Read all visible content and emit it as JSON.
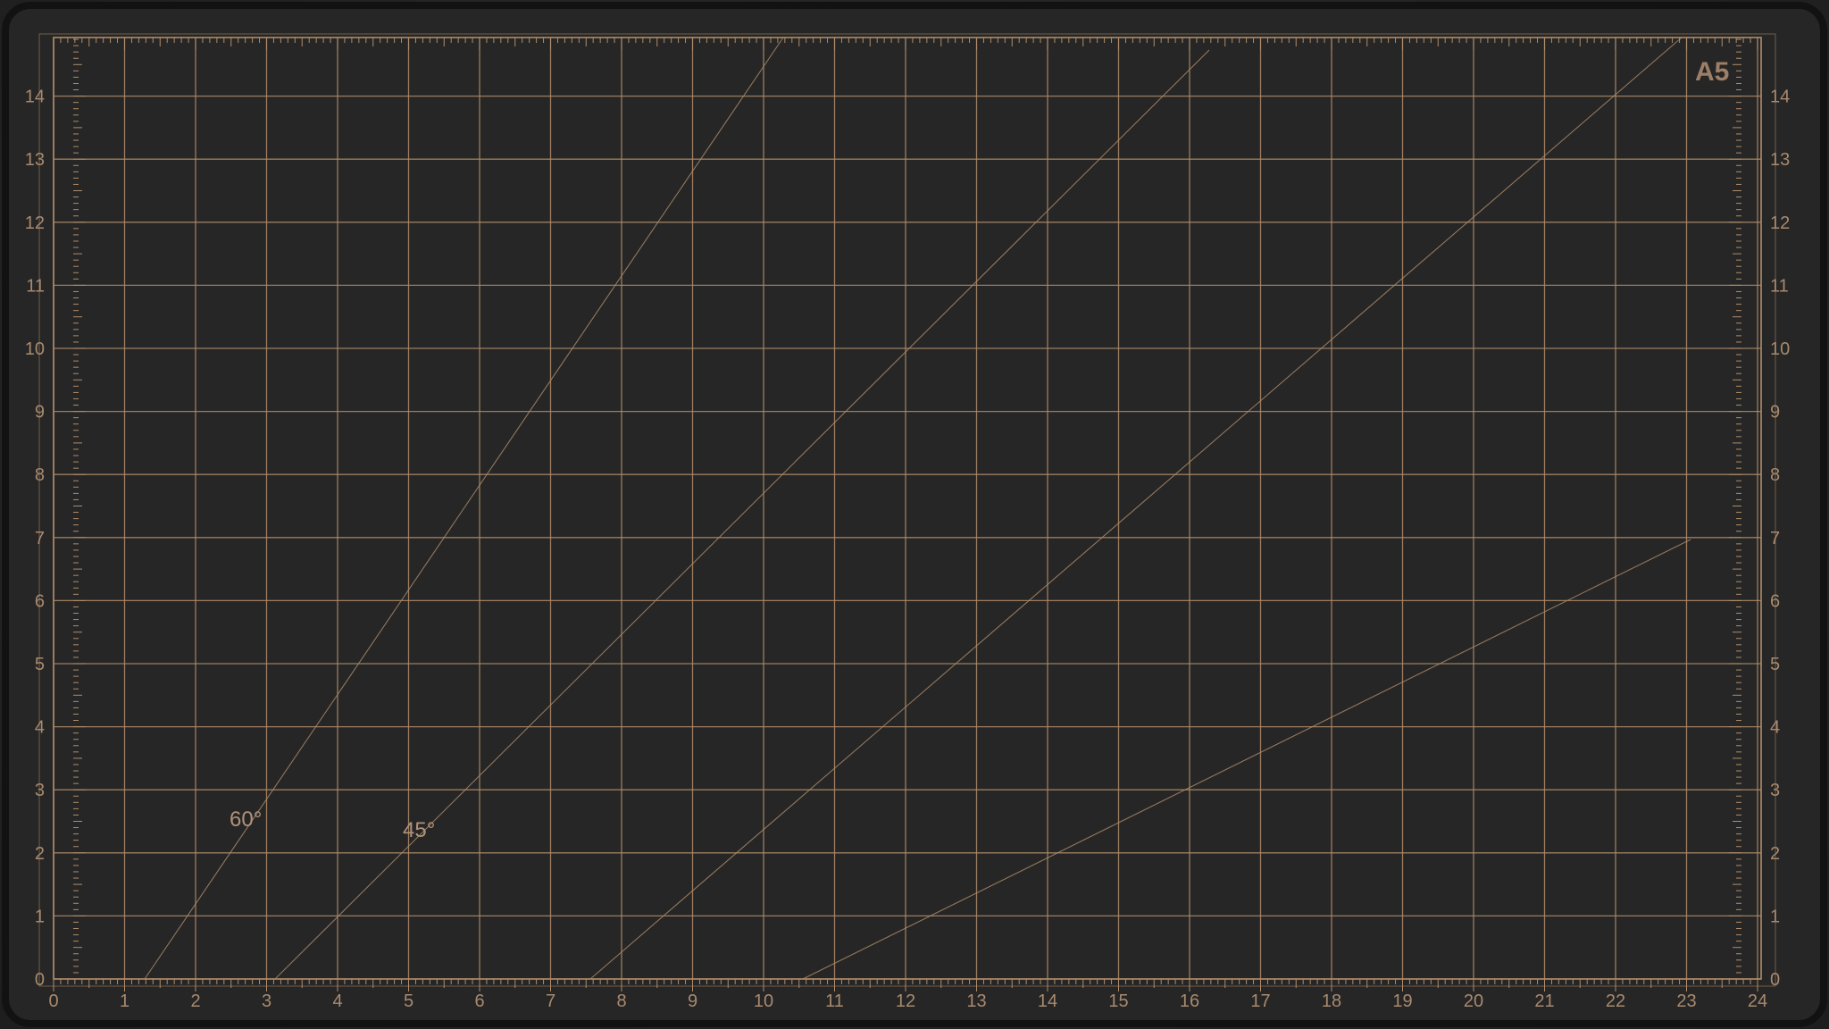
{
  "mat": {
    "size_label": "A5",
    "line_color": "#b08c6a",
    "base_color": "#262626",
    "edge_color": "#0f0f0f"
  },
  "bottom_scale": [
    "0",
    "1",
    "2",
    "3",
    "4",
    "5",
    "6",
    "7",
    "8",
    "9",
    "10",
    "11",
    "12",
    "13",
    "14",
    "15",
    "16",
    "17",
    "18",
    "19",
    "20",
    "21",
    "22",
    "23",
    "24"
  ],
  "left_scale": [
    "0",
    "1",
    "2",
    "3",
    "4",
    "5",
    "6",
    "7",
    "8",
    "9",
    "10",
    "11",
    "12",
    "13",
    "14",
    "10"
  ],
  "right_scale": [
    "0",
    "1",
    "2",
    "3",
    "4",
    "5",
    "6",
    "7",
    "8",
    "9",
    "10",
    "11",
    "12",
    "13",
    "14",
    "10"
  ],
  "angle_labels": {
    "sixty": "60°",
    "forty_five": "45°"
  }
}
